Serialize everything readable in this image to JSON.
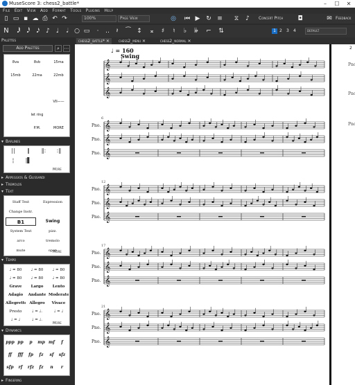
{
  "window": {
    "title": "MuseScore 3: chess2_battle*",
    "min": "–",
    "max": "☐",
    "close": "✕"
  },
  "menu": [
    "File",
    "Edit",
    "View",
    "Add",
    "Format",
    "Tools",
    "Plugins",
    "Help"
  ],
  "toolbar": {
    "zoom": "100%",
    "view_mode": "Page View",
    "concert_pitch": "Concert Pitch",
    "feedback": "Feedback"
  },
  "toolbar2": {
    "voices": [
      "1",
      "2",
      "3",
      "4"
    ],
    "layout": "default"
  },
  "palettes": {
    "header": "Palettes",
    "add_button": "Add Palettes",
    "sections": {
      "barlines": "Barlines",
      "arpeggios": "Arpeggios & Glissandi",
      "tremolos": "Tremolos",
      "text": "Text",
      "tempo": "Tempo",
      "dynamics": "Dynamics",
      "fingering": "Fingering"
    },
    "more": "More",
    "lines_cells": [
      "8va",
      "8vb",
      "15ma",
      "15mb",
      "22ma",
      "22mb",
      "",
      "",
      "",
      "",
      "",
      "VII——",
      "",
      "let ring",
      "",
      "",
      "P.M.",
      "MORE"
    ],
    "text_cells": [
      "Staff Text",
      "Expression",
      "Change Instr.",
      "",
      "B1",
      "Swing",
      "System Text",
      "pizz.",
      "arco",
      "tremolo",
      "mute",
      "open"
    ],
    "tempo_cells": [
      "♩ = 80",
      "♩ = 80",
      "♩ = 80",
      "♩ = 80",
      "♩ = 80",
      "♩ = 80",
      "Grave",
      "Largo",
      "Lento",
      "Adagio",
      "Andante",
      "Moderato",
      "Allegretto",
      "Allegro",
      "Vivace",
      "Presto",
      "♩ = ♩.",
      "♩ = ♩",
      "♩ = ♩",
      "♩ = ♩."
    ],
    "dynamics_cells": [
      "ppp",
      "pp",
      "p",
      "mp",
      "mf",
      "f",
      "ff",
      "fff",
      "fp",
      "fz",
      "sf",
      "sfz",
      "sfp",
      "rf",
      "rfz",
      "fz",
      "n",
      "r"
    ]
  },
  "tabs": [
    {
      "label": "chess2_battle*",
      "close": "✕"
    },
    {
      "label": "chess2_menu",
      "close": "✕"
    },
    {
      "label": "chess2_normal",
      "close": "✕"
    }
  ],
  "score": {
    "tempo": "♩ = 160",
    "swing": "Swing",
    "systems": [
      {
        "measure": ""
      },
      {
        "measure": "6"
      },
      {
        "measure": "12"
      },
      {
        "measure": "17"
      },
      {
        "measure": "21"
      }
    ],
    "staff_label": "Pno.",
    "right_page_number": "2"
  },
  "colors": {
    "panel": "#2b2b2b",
    "accent": "#1a6fc4",
    "paper": "#ffffff"
  }
}
